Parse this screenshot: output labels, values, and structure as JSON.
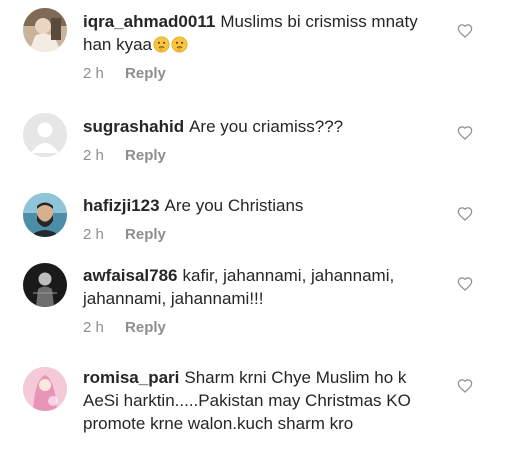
{
  "comments": [
    {
      "username": "iqra_ahmad0011",
      "text": "Muslims bi crismiss mnaty han kyaa",
      "time": "2 h",
      "reply_label": "Reply",
      "avatar_icon": "profile-photo",
      "emojis": [
        "thinking-face-emoji",
        "thinking-face-emoji"
      ]
    },
    {
      "username": "sugrashahid",
      "text": "Are you criamiss???",
      "time": "2 h",
      "reply_label": "Reply",
      "avatar_icon": "default-avatar"
    },
    {
      "username": "hafizji123",
      "text": "Are you Christians",
      "time": "2 h",
      "reply_label": "Reply",
      "avatar_icon": "profile-photo"
    },
    {
      "username": "awfaisal786",
      "text": "kafir, jahannami, jahannami, jahannami, jahannami!!!",
      "time": "2 h",
      "reply_label": "Reply",
      "avatar_icon": "profile-photo"
    },
    {
      "username": "romisa_pari",
      "text": "Sharm krni Chye Muslim ho k AeSi harktin.....Pakistan may Christmas KO promote krne walon.kuch sharm kro",
      "avatar_icon": "profile-photo"
    }
  ],
  "colors": {
    "text": "#262626",
    "secondary": "#8e8e8e",
    "background": "#ffffff"
  },
  "icons": {
    "like": "heart-outline-icon"
  }
}
